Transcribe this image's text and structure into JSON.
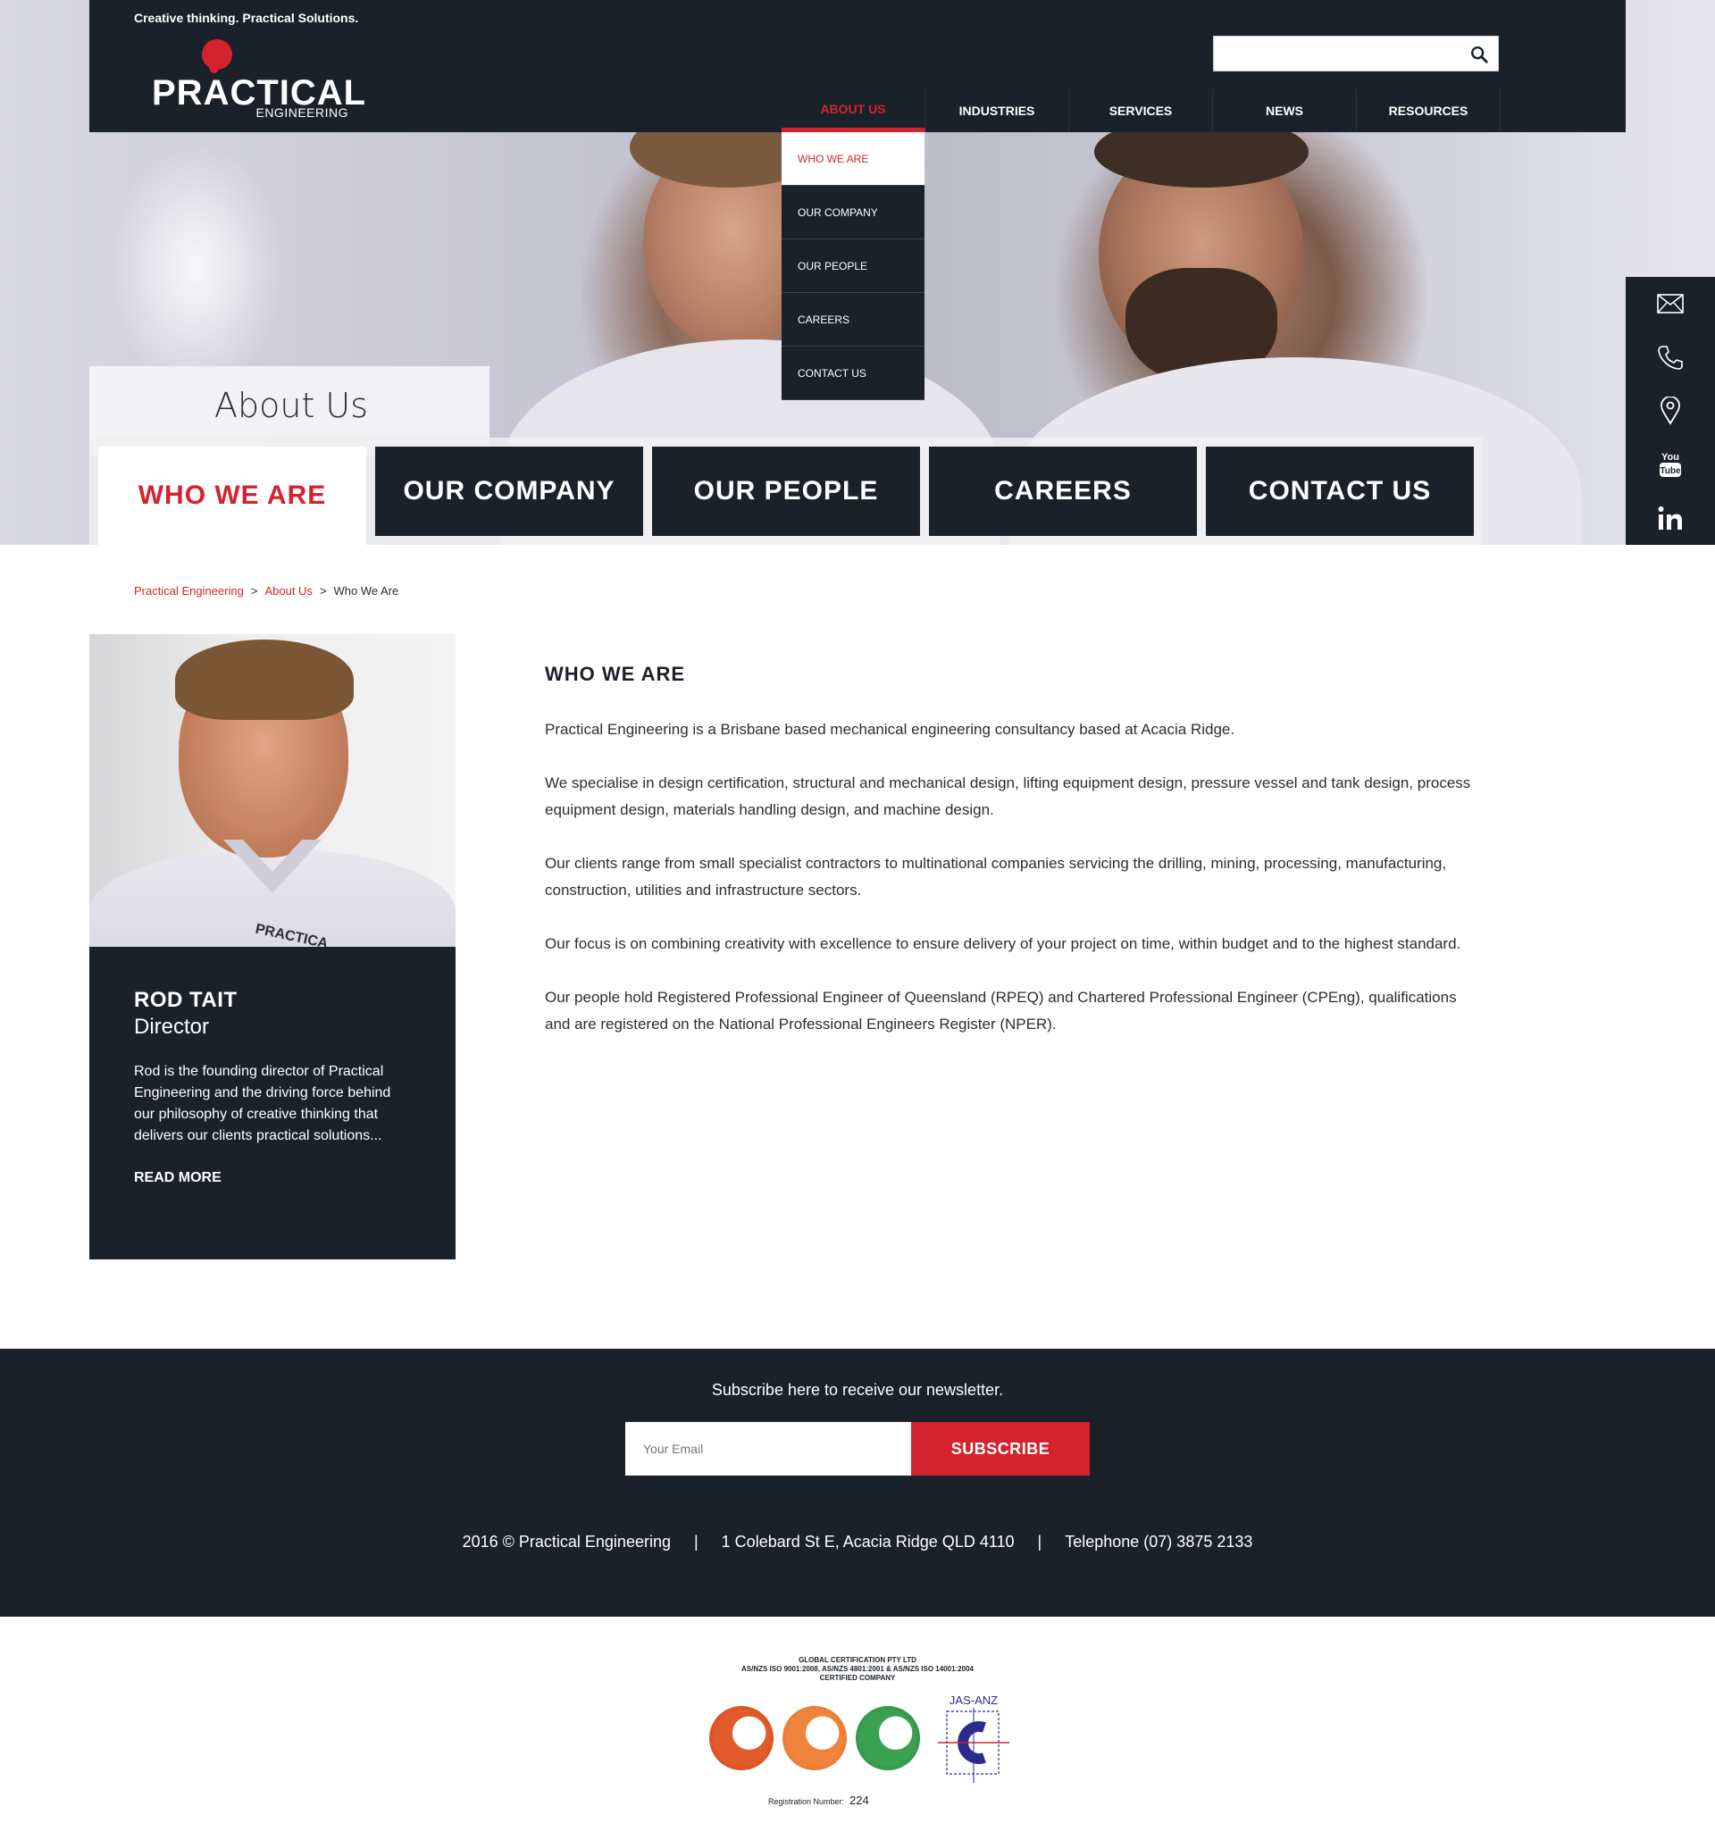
{
  "header": {
    "tagline": "Creative thinking. Practical Solutions.",
    "logo_word": "PRACTICAL",
    "logo_sub": "ENGINEERING",
    "search_placeholder": ""
  },
  "nav": {
    "items": [
      {
        "label": "ABOUT US"
      },
      {
        "label": "INDUSTRIES"
      },
      {
        "label": "SERVICES"
      },
      {
        "label": "NEWS"
      },
      {
        "label": "RESOURCES"
      }
    ],
    "dropdown": [
      {
        "label": "WHO WE ARE"
      },
      {
        "label": "OUR COMPANY"
      },
      {
        "label": "OUR PEOPLE"
      },
      {
        "label": "CAREERS"
      },
      {
        "label": "CONTACT US"
      }
    ]
  },
  "hero": {
    "title": "About Us",
    "tabs": [
      {
        "label": "WHO WE ARE"
      },
      {
        "label": "OUR COMPANY"
      },
      {
        "label": "OUR PEOPLE"
      },
      {
        "label": "CAREERS"
      },
      {
        "label": "CONTACT US"
      }
    ]
  },
  "social": [
    "email-icon",
    "phone-icon",
    "location-pin-icon",
    "youtube-icon",
    "linkedin-icon"
  ],
  "breadcrumb": {
    "home": "Practical Engineering",
    "section": "About Us",
    "current": "Who We Are",
    "sep": ">"
  },
  "profile": {
    "photo_logo": "PRACTICA",
    "name": "ROD TAIT",
    "role": "Director",
    "description": "Rod is the founding director of Practical Engineering and the driving force behind our philosophy of creative thinking that delivers our clients practical solutions...",
    "read_more": "READ MORE"
  },
  "article": {
    "heading": "WHO WE ARE",
    "paragraphs": [
      "Practical Engineering is a Brisbane based mechanical engineering consultancy based at Acacia Ridge.",
      "We specialise in design certification, structural and mechanical design, lifting equipment design, pressure vessel and tank design, process equipment design, materials handling design, and machine design.",
      "Our clients range from small specialist contractors to multinational companies servicing the drilling, mining, processing, manufacturing, construction, utilities and infrastructure sectors.",
      "Our focus is on combining creativity with excellence to ensure delivery of your project on time, within budget and to the highest standard.",
      "Our people hold Registered Professional Engineer of Queensland (RPEQ) and Chartered Professional Engineer (CPEng), qualifications and are registered on the National Professional Engineers Register (NPER)."
    ]
  },
  "footer": {
    "newsletter_text": "Subscribe here to receive our newsletter.",
    "email_placeholder": "Your Email",
    "subscribe_label": "SUBSCRIBE",
    "copyright": "2016 © Practical Engineering",
    "address": "1 Colebard St E, Acacia Ridge QLD 4110",
    "telephone": "Telephone (07) 3875 2133",
    "divider": "|"
  },
  "certification": {
    "line1": "GLOBAL CERTIFICATION PTY LTD",
    "line2": "AS/NZS ISO 9001:2008, AS/NZS 4801:2001 & AS/NZS ISO 14001:2004",
    "line3": "CERTIFIED COMPANY",
    "jas_label": "JAS-ANZ",
    "reg_label": "Registration Number:",
    "reg_number": "224"
  },
  "colors": {
    "brand_red": "#d4232f",
    "dark_navy": "#1b2128",
    "white": "#ffffff"
  }
}
